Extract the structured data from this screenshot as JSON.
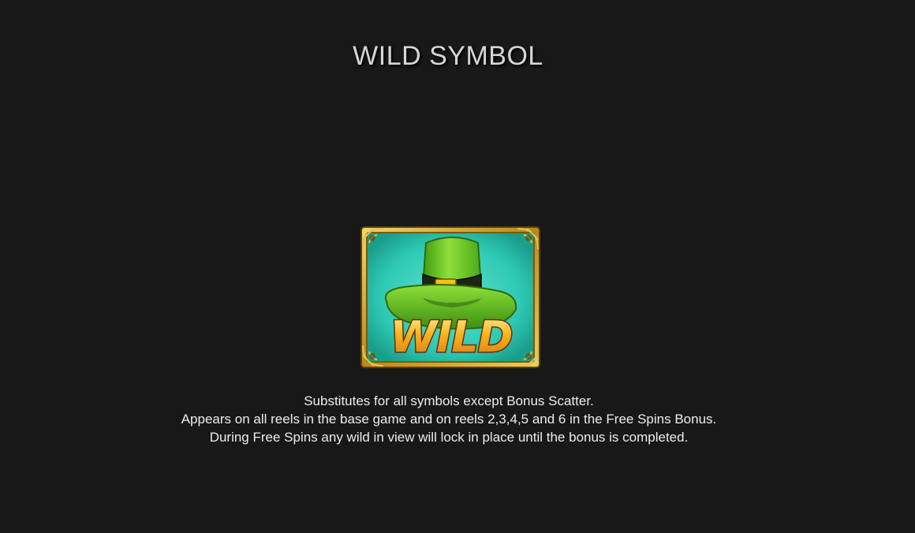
{
  "title": "WILD SYMBOL",
  "symbol": {
    "icon": "leprechaun-hat-wild-icon",
    "label": "WILD",
    "colors": {
      "background": "#2ec9b3",
      "frame": "#c9a227",
      "hat": "#6fcf2a",
      "buckle": "#f4c21c",
      "lettering": "#f2a81c"
    }
  },
  "description": {
    "line1": "Substitutes for all symbols except Bonus Scatter.",
    "line2": "Appears on all reels in the base game and on reels 2,3,4,5 and 6 in the Free Spins Bonus.",
    "line3": "During Free Spins any wild in view will lock in place until the bonus is completed."
  }
}
